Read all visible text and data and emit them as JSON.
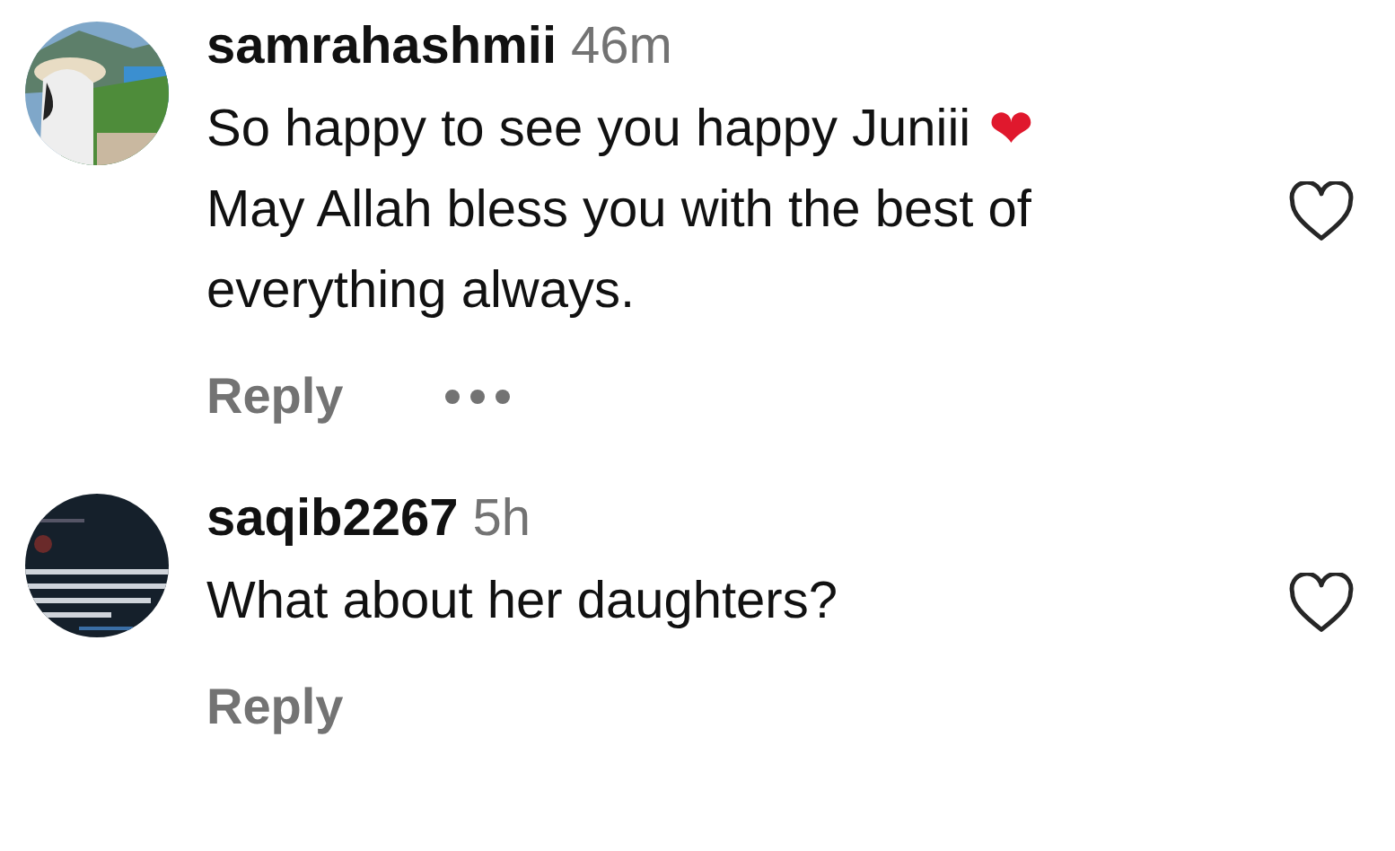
{
  "comments": [
    {
      "avatar": {
        "kind": "picture"
      },
      "username": "samrahashmii",
      "time": "46m",
      "lines": [
        {
          "text": "So happy to see you happy Juniii",
          "emoji": "❤"
        },
        {
          "text": "May Allah bless you with the best of"
        },
        {
          "text": "everything always."
        }
      ],
      "reply": "Reply",
      "has_more": true,
      "liked": false
    },
    {
      "avatar": {
        "kind": "picture"
      },
      "username": "saqib2267",
      "time": "5h",
      "lines": [
        {
          "text": "What about her daughters?"
        }
      ],
      "reply": "Reply",
      "has_more": false,
      "liked": false
    }
  ]
}
